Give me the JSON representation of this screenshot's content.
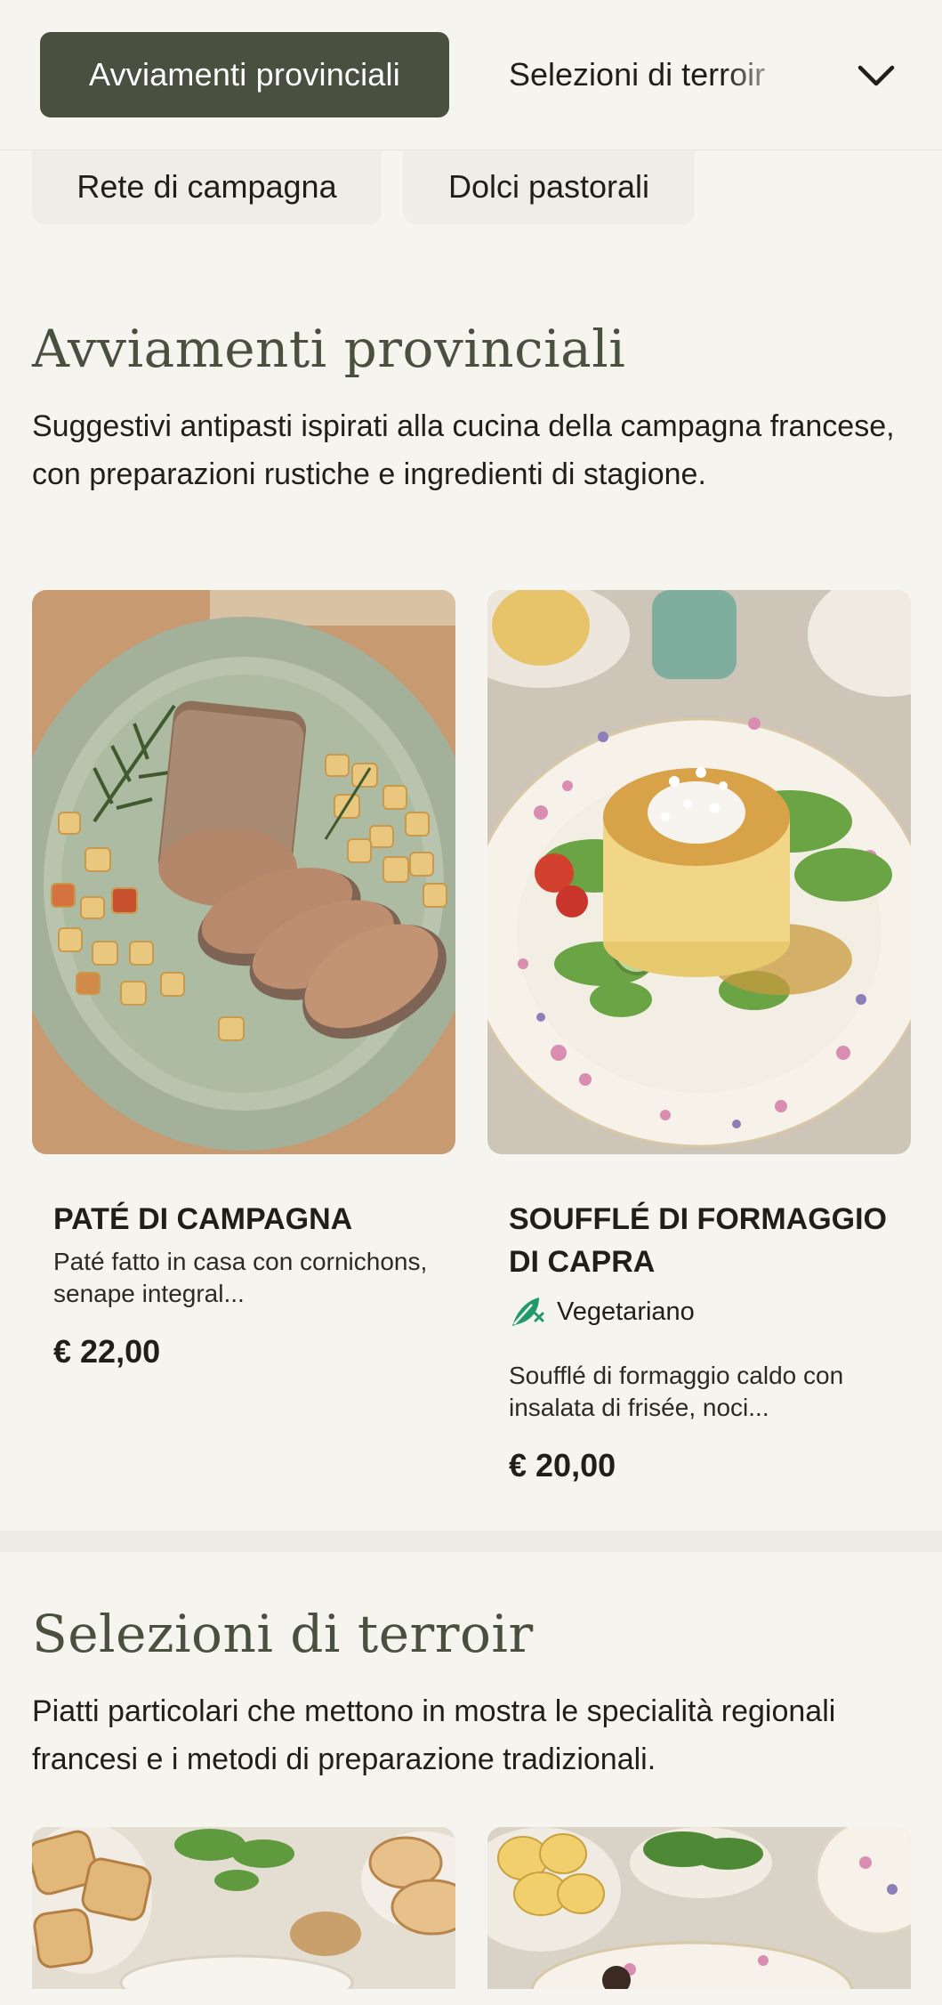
{
  "nav": {
    "active_tab": "Avviamenti provinciali",
    "next_tab": "Selezioni di terroir",
    "expand_icon": "chevron-down-icon",
    "row2": [
      "Rete di campagna",
      "Dolci pastorali"
    ]
  },
  "sections": [
    {
      "title": "Avviamenti provinciali",
      "description": "Suggestivi antipasti ispirati alla cucina della campagna francese, con preparazioni rustiche e ingredienti di stagione.",
      "items": [
        {
          "name": "PATÉ DI CAMPAGNA",
          "description": "Paté fatto in casa con cornichons, senape integral...",
          "price": "€ 22,00"
        },
        {
          "name": "SOUFFLÉ DI FORMAGGIO DI CAPRA",
          "badge": "Vegetariano",
          "badge_icon": "vegetarian-leaf-icon",
          "description": "Soufflé di formaggio caldo con insalata di frisée, noci...",
          "price": "€ 20,00"
        }
      ]
    },
    {
      "title": "Selezioni di terroir",
      "description": "Piatti particolari che mettono in mostra le specialità regionali francesi e i metodi di preparazione tradizionali."
    }
  ],
  "colors": {
    "background": "#f6f4ef",
    "accent": "#4a5040",
    "badge_green": "#1f9a6b"
  }
}
